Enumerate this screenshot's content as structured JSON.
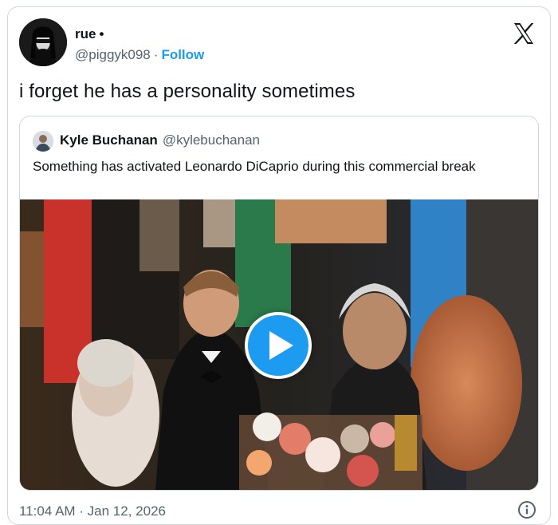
{
  "tweet": {
    "author_name": "rue",
    "author_dot": "•",
    "author_handle": "@piggyk098",
    "separator": "·",
    "follow_label": "Follow",
    "text": "i forget he has a personality sometimes",
    "timestamp": "11:04 AM · Jan 12, 2026"
  },
  "quote": {
    "author_name": "Kyle Buchanan",
    "author_handle": "@kylebuchanan",
    "text": "Something has activated Leonardo DiCaprio during this commercial break"
  },
  "icons": {
    "brand": "x-logo-icon",
    "media_action": "play-icon",
    "info": "info-icon"
  },
  "colors": {
    "accent": "#1d9bf0",
    "text_primary": "#0f1419",
    "text_secondary": "#536471",
    "border": "#cfd9de"
  }
}
